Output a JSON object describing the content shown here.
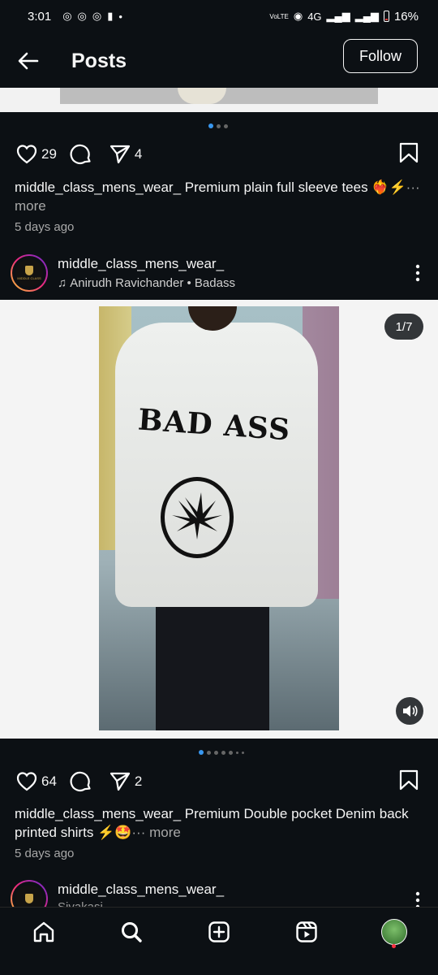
{
  "status_bar": {
    "time": "3:01",
    "network": "4G",
    "battery": "16%",
    "volte": "VoLTE"
  },
  "header": {
    "title": "Posts",
    "follow_label": "Follow"
  },
  "post1": {
    "likes": "29",
    "shares": "4",
    "caption_user": "middle_class_mens_wear_",
    "caption_text": " Premium plain  full sleeve tees ❤️‍🔥⚡",
    "more": "··· more",
    "time_ago": "5 days ago"
  },
  "post2": {
    "username": "middle_class_mens_wear_",
    "audio": "Anirudh Ravichander • Badass",
    "image_counter": "1/7",
    "print_text": "BAD ASS",
    "likes": "64",
    "shares": "2",
    "caption_user": "middle_class_mens_wear_",
    "caption_text": " Premium Double pocket Denim back printed shirts ⚡🤩",
    "more": "··· more",
    "time_ago": "5 days ago"
  },
  "post3": {
    "username": "middle_class_mens_wear_",
    "subline": "Sivakasi"
  },
  "avatar_text": "MIDDLE CLASS",
  "colors": {
    "background": "#0c1014",
    "accent_blue": "#3897f0",
    "muted_text": "#a8a8a8"
  },
  "nav": [
    "home-icon",
    "search-icon",
    "create-icon",
    "reels-icon",
    "profile-avatar"
  ]
}
